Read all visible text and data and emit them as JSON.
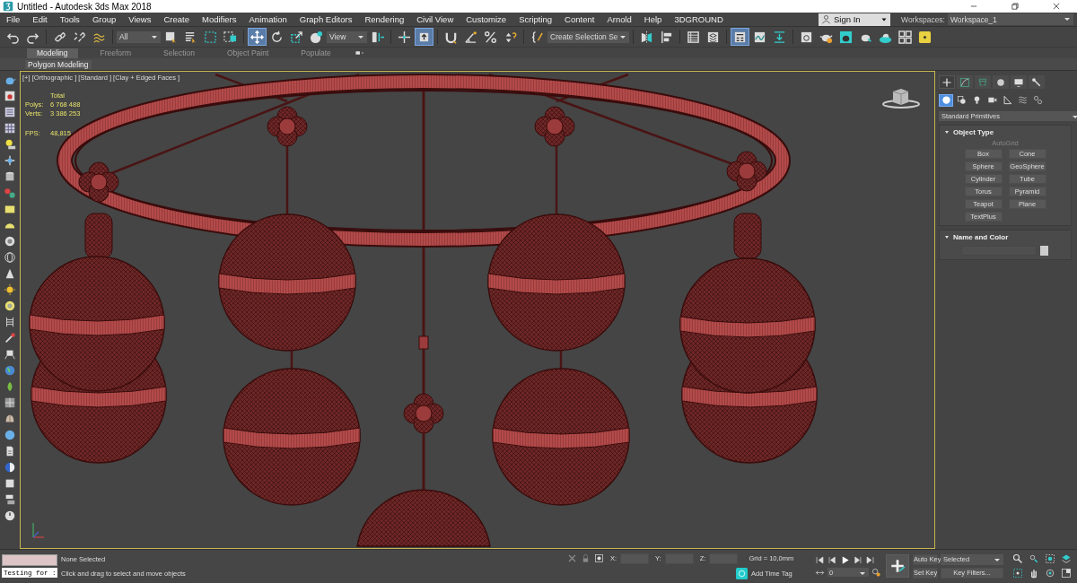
{
  "window": {
    "title": "Untitled - Autodesk 3ds Max 2018"
  },
  "menu": [
    "File",
    "Edit",
    "Tools",
    "Group",
    "Views",
    "Create",
    "Modifiers",
    "Animation",
    "Graph Editors",
    "Rendering",
    "Civil View",
    "Customize",
    "Scripting",
    "Content",
    "Arnold",
    "Help",
    "3DGROUND"
  ],
  "account": {
    "label": "Sign In"
  },
  "workspaces": {
    "label": "Workspaces:",
    "value": "Workspace_1"
  },
  "toolbar": [
    {
      "kind": "button",
      "selected": false
    },
    {
      "kind": "button",
      "selected": false
    },
    {
      "kind": "separator"
    },
    {
      "kind": "button",
      "selected": false
    },
    {
      "kind": "button",
      "selected": false
    },
    {
      "kind": "button",
      "selected": false
    },
    {
      "kind": "separator"
    },
    {
      "kind": "dropdown",
      "value": "All"
    },
    {
      "kind": "button",
      "selected": false
    },
    {
      "kind": "button",
      "selected": false
    },
    {
      "kind": "button",
      "selected": false
    },
    {
      "kind": "button",
      "selected": false
    },
    {
      "kind": "separator"
    },
    {
      "kind": "button",
      "selected": true
    },
    {
      "kind": "button",
      "selected": false
    },
    {
      "kind": "button",
      "selected": false
    },
    {
      "kind": "button",
      "selected": false
    },
    {
      "kind": "dropdown",
      "value": "View"
    },
    {
      "kind": "button",
      "selected": false
    },
    {
      "kind": "separator"
    },
    {
      "kind": "button",
      "selected": false
    },
    {
      "kind": "button",
      "selected": true
    },
    {
      "kind": "separator"
    },
    {
      "kind": "button",
      "selected": false
    },
    {
      "kind": "button",
      "selected": false
    },
    {
      "kind": "button",
      "selected": false
    },
    {
      "kind": "button",
      "selected": false
    },
    {
      "kind": "separator"
    },
    {
      "kind": "button",
      "selected": false
    },
    {
      "kind": "dropdown",
      "value": "Create Selection Se"
    },
    {
      "kind": "separator"
    },
    {
      "kind": "button",
      "selected": false
    },
    {
      "kind": "button",
      "selected": false
    },
    {
      "kind": "separator"
    },
    {
      "kind": "button",
      "selected": false
    },
    {
      "kind": "button",
      "selected": false
    },
    {
      "kind": "separator"
    },
    {
      "kind": "button",
      "selected": true
    },
    {
      "kind": "button",
      "selected": false
    },
    {
      "kind": "button",
      "selected": false
    },
    {
      "kind": "separator"
    },
    {
      "kind": "button",
      "selected": false
    },
    {
      "kind": "button",
      "selected": false
    },
    {
      "kind": "button",
      "selected": false
    },
    {
      "kind": "button",
      "selected": false
    },
    {
      "kind": "button",
      "selected": false
    },
    {
      "kind": "button",
      "selected": false
    },
    {
      "kind": "button",
      "selected": false
    }
  ],
  "ribbon": {
    "tabs": [
      {
        "label": "Modeling",
        "selected": true
      },
      {
        "label": "Freeform",
        "selected": false
      },
      {
        "label": "Selection",
        "selected": false
      },
      {
        "label": "Object Paint",
        "selected": false
      },
      {
        "label": "Populate",
        "selected": false
      }
    ],
    "panel_label": "Polygon Modeling"
  },
  "viewport": {
    "label": "[+] [Orthographic ] [Standard ] [Clay + Edged Faces ]",
    "active": true,
    "stats": {
      "header": "Total",
      "rows": [
        {
          "label": "Polys:",
          "value": "6 768 488"
        },
        {
          "label": "Verts:",
          "value": "3 386 253"
        },
        {
          "label": "FPS:",
          "value": "48,815"
        }
      ]
    }
  },
  "command_panel": {
    "tabs": [
      {
        "selected": true
      },
      {
        "selected": false
      },
      {
        "selected": false
      },
      {
        "selected": false
      },
      {
        "selected": false
      },
      {
        "selected": false
      }
    ],
    "categories": [
      {
        "selected": true
      },
      {
        "selected": false
      },
      {
        "selected": false
      },
      {
        "selected": false
      },
      {
        "selected": false
      },
      {
        "selected": false
      },
      {
        "selected": false
      }
    ],
    "type_dropdown": "Standard Primitives",
    "object_type": {
      "title": "Object Type",
      "autogrid": {
        "label": "AutoGrid",
        "disabled": true
      },
      "buttons": [
        "Box",
        "Cone",
        "Sphere",
        "GeoSphere",
        "Cylinder",
        "Tube",
        "Torus",
        "Pyramid",
        "Teapot",
        "Plane",
        "TextPlus"
      ]
    },
    "name_and_color": {
      "title": "Name and Color"
    }
  },
  "status": {
    "maxscript": "Testing for :",
    "selection": "None Selected",
    "prompt": "Click and drag to select and move objects",
    "coords": [
      {
        "label": "X:"
      },
      {
        "label": "Y:"
      },
      {
        "label": "Z:"
      }
    ],
    "grid": "Grid = 10,0mm",
    "time_tag": "Add Time Tag",
    "frame": "0",
    "auto_key": "Auto Key",
    "key_mode": "Selected",
    "set_key": "Set Key",
    "key_filters": "Key Filters..."
  }
}
